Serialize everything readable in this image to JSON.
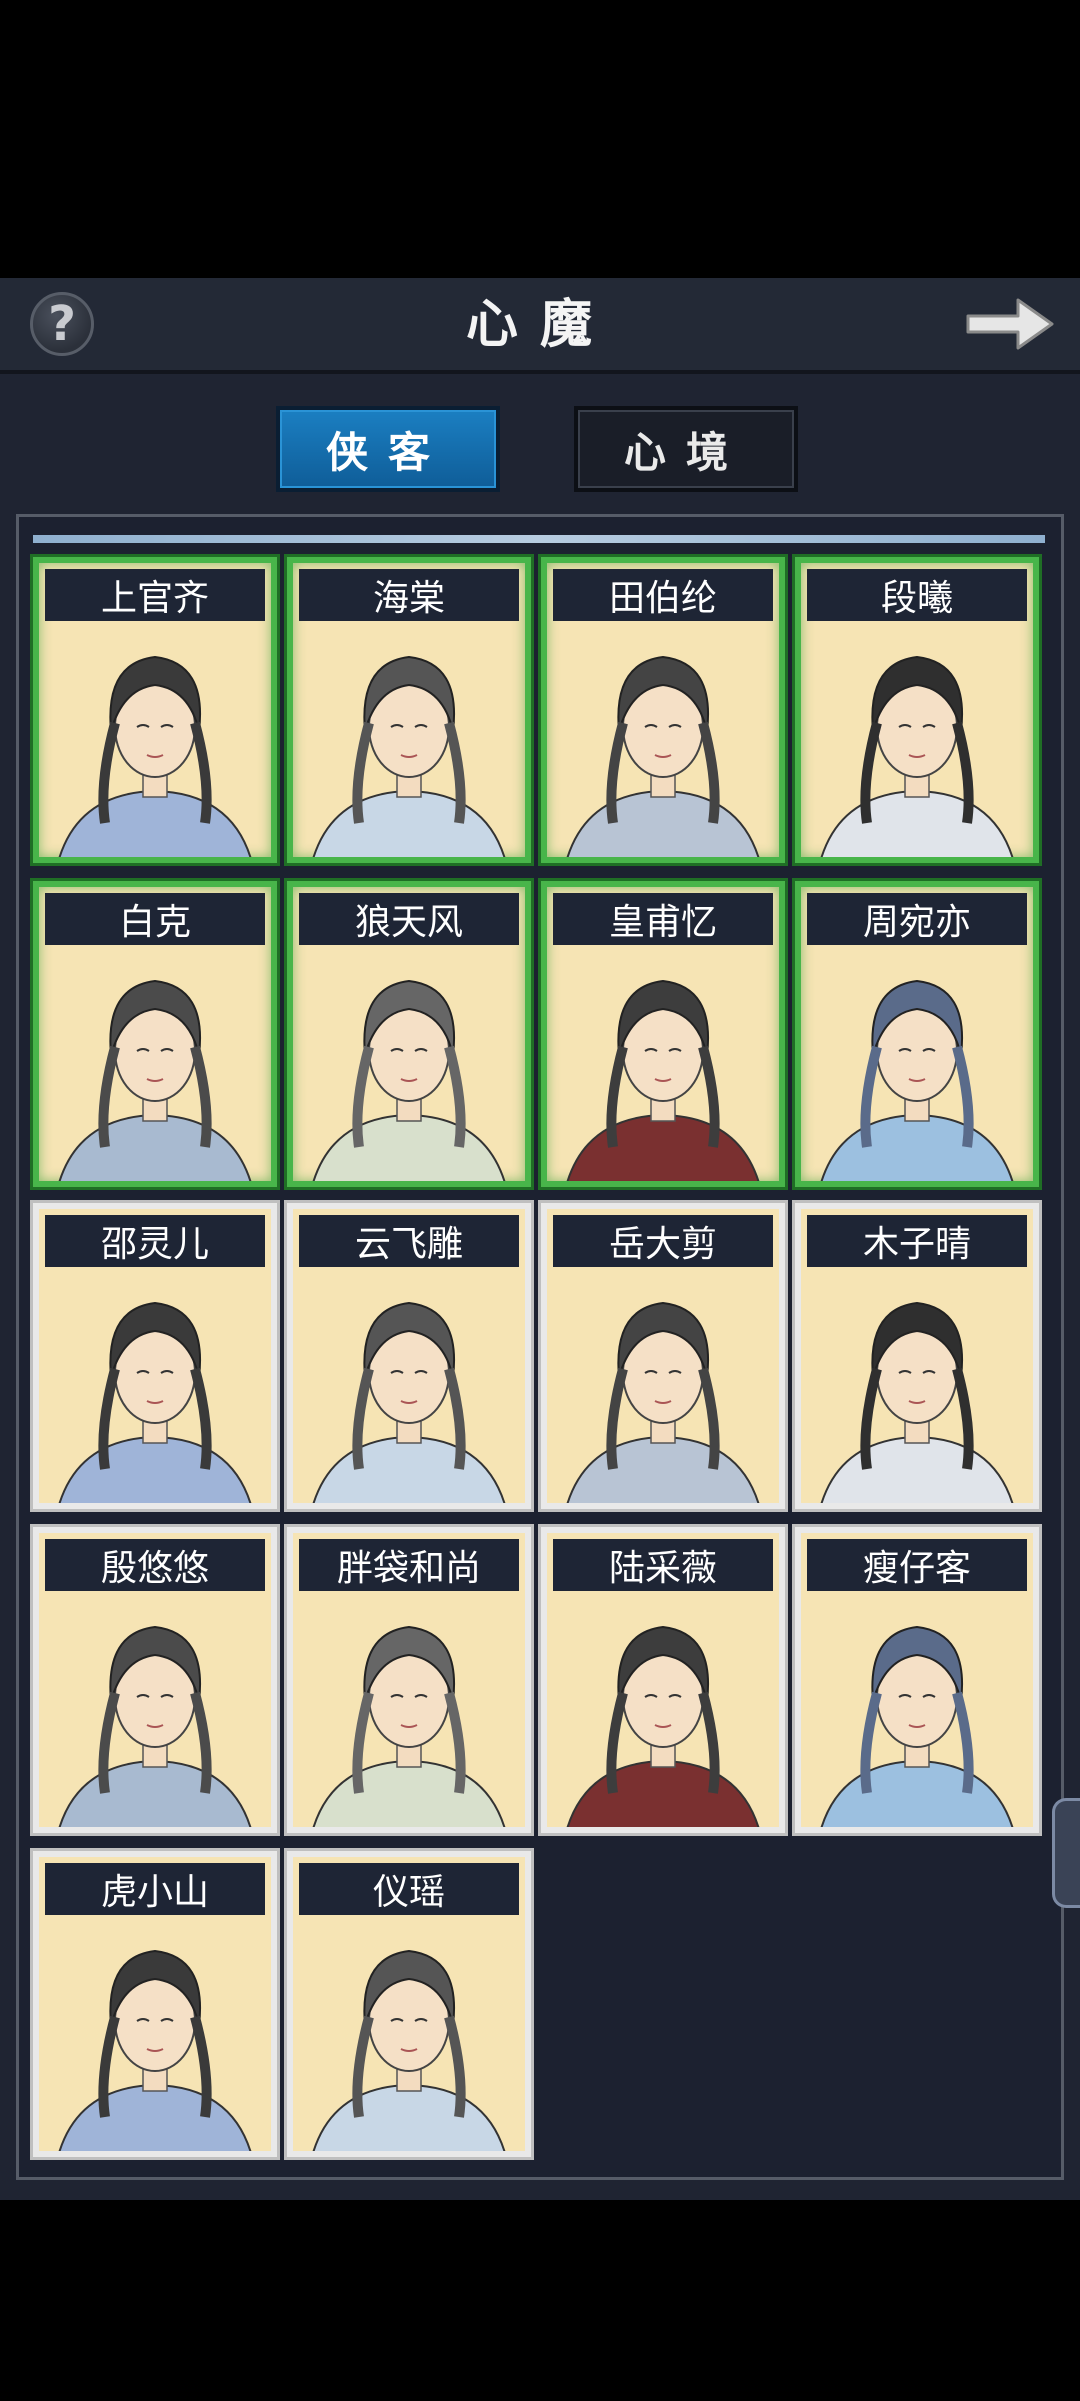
{
  "header": {
    "title": "心魔",
    "help_label": "?"
  },
  "tabs": [
    {
      "label": "侠客",
      "active": true
    },
    {
      "label": "心境",
      "active": false
    }
  ],
  "colors": {
    "accent": "#1b7fc2",
    "unlocked_border": "#48b54a",
    "card_bg": "#f6e4b4"
  },
  "characters": [
    {
      "name": "上官齐",
      "unlocked": true
    },
    {
      "name": "海棠",
      "unlocked": true
    },
    {
      "name": "田伯纶",
      "unlocked": true
    },
    {
      "name": "段曦",
      "unlocked": true
    },
    {
      "name": "白克",
      "unlocked": true
    },
    {
      "name": "狼天风",
      "unlocked": true
    },
    {
      "name": "皇甫忆",
      "unlocked": true
    },
    {
      "name": "周宛亦",
      "unlocked": true
    },
    {
      "name": "邵灵儿",
      "unlocked": false
    },
    {
      "name": "云飞雕",
      "unlocked": false
    },
    {
      "name": "岳大剪",
      "unlocked": false
    },
    {
      "name": "木子晴",
      "unlocked": false
    },
    {
      "name": "殷悠悠",
      "unlocked": false
    },
    {
      "name": "胖袋和尚",
      "unlocked": false
    },
    {
      "name": "陆采薇",
      "unlocked": false
    },
    {
      "name": "瘦仔客",
      "unlocked": false
    },
    {
      "name": "虎小山",
      "unlocked": false
    },
    {
      "name": "仪瑶",
      "unlocked": false
    }
  ]
}
